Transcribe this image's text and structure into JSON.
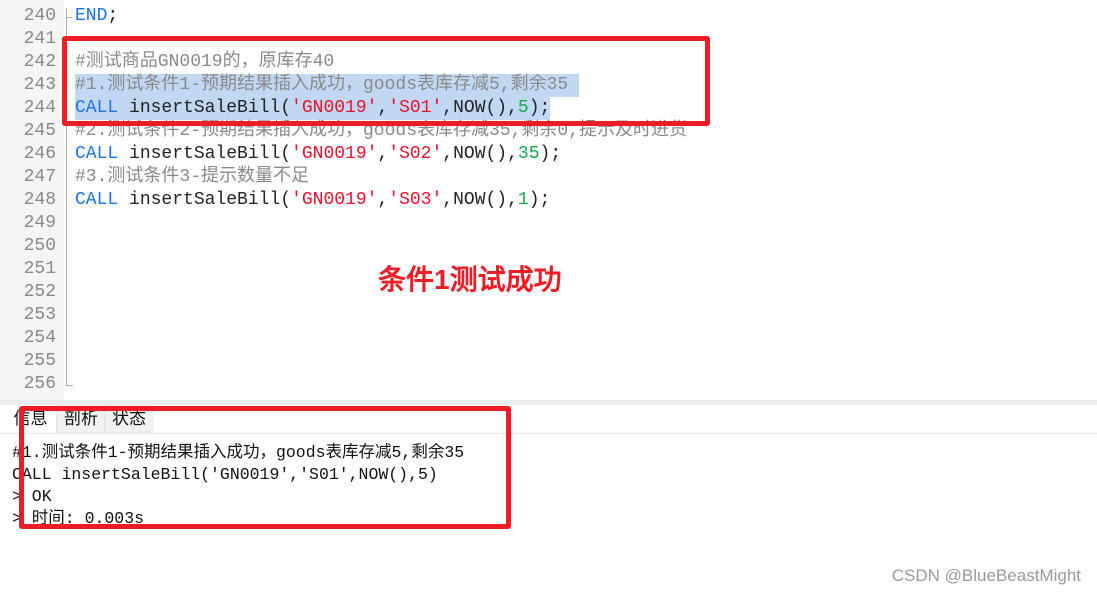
{
  "editor": {
    "lines": [
      {
        "n": "240",
        "parts": [
          {
            "t": "END",
            "c": "kw"
          },
          {
            "t": ";",
            "c": ""
          }
        ]
      },
      {
        "n": "241",
        "parts": []
      },
      {
        "n": "242",
        "parts": [
          {
            "t": "#测试商品GN0019的，原库存40",
            "c": "cm"
          }
        ]
      },
      {
        "n": "243",
        "sel": true,
        "parts": [
          {
            "t": "#1.测试条件1-预期结果插入成功，goods表库存减5,剩余35 ",
            "c": "cm"
          }
        ]
      },
      {
        "n": "244",
        "sel": true,
        "parts": [
          {
            "t": "CALL",
            "c": "kw"
          },
          {
            "t": " insertSaleBill(",
            "c": ""
          },
          {
            "t": "'GN0019'",
            "c": "str"
          },
          {
            "t": ",",
            "c": ""
          },
          {
            "t": "'S01'",
            "c": "str"
          },
          {
            "t": ",NOW(),",
            "c": ""
          },
          {
            "t": "5",
            "c": "num"
          },
          {
            "t": ");",
            "c": ""
          }
        ]
      },
      {
        "n": "245",
        "parts": [
          {
            "t": "#2.测试条件2-预期结果插入成功，goods表库存减35,剩余0,提示及时进货",
            "c": "cm"
          }
        ]
      },
      {
        "n": "246",
        "parts": [
          {
            "t": "CALL",
            "c": "kw"
          },
          {
            "t": " insertSaleBill(",
            "c": ""
          },
          {
            "t": "'GN0019'",
            "c": "str"
          },
          {
            "t": ",",
            "c": ""
          },
          {
            "t": "'S02'",
            "c": "str"
          },
          {
            "t": ",NOW(),",
            "c": ""
          },
          {
            "t": "35",
            "c": "num"
          },
          {
            "t": ");",
            "c": ""
          }
        ]
      },
      {
        "n": "247",
        "parts": [
          {
            "t": "#3.测试条件3-提示数量不足",
            "c": "cm"
          }
        ]
      },
      {
        "n": "248",
        "parts": [
          {
            "t": "CALL",
            "c": "kw"
          },
          {
            "t": " insertSaleBill(",
            "c": ""
          },
          {
            "t": "'GN0019'",
            "c": "str"
          },
          {
            "t": ",",
            "c": ""
          },
          {
            "t": "'S03'",
            "c": "str"
          },
          {
            "t": ",NOW(),",
            "c": ""
          },
          {
            "t": "1",
            "c": "num"
          },
          {
            "t": ");",
            "c": ""
          }
        ]
      },
      {
        "n": "249",
        "parts": []
      },
      {
        "n": "250",
        "parts": []
      },
      {
        "n": "251",
        "parts": []
      },
      {
        "n": "252",
        "parts": []
      },
      {
        "n": "253",
        "parts": []
      },
      {
        "n": "254",
        "parts": []
      },
      {
        "n": "255",
        "parts": []
      },
      {
        "n": "256",
        "parts": []
      }
    ]
  },
  "panel": {
    "tabs": [
      {
        "label": "信息",
        "active": true
      },
      {
        "label": "剖析",
        "active": false
      },
      {
        "label": "状态",
        "active": false
      }
    ],
    "output": [
      "#1.测试条件1-预期结果插入成功，goods表库存减5,剩余35",
      "CALL insertSaleBill('GN0019','S01',NOW(),5)",
      "> OK",
      "> 时间: 0.003s"
    ]
  },
  "annotation": {
    "caption": "条件1测试成功",
    "color": "#ee1c25"
  },
  "watermark": "CSDN @BlueBeastMight",
  "colors": {
    "keyword": "#1a73e8",
    "string": "#e8102a",
    "number": "#19a84a",
    "comment": "#8a8a8a",
    "selection": "#c2d8f2"
  }
}
